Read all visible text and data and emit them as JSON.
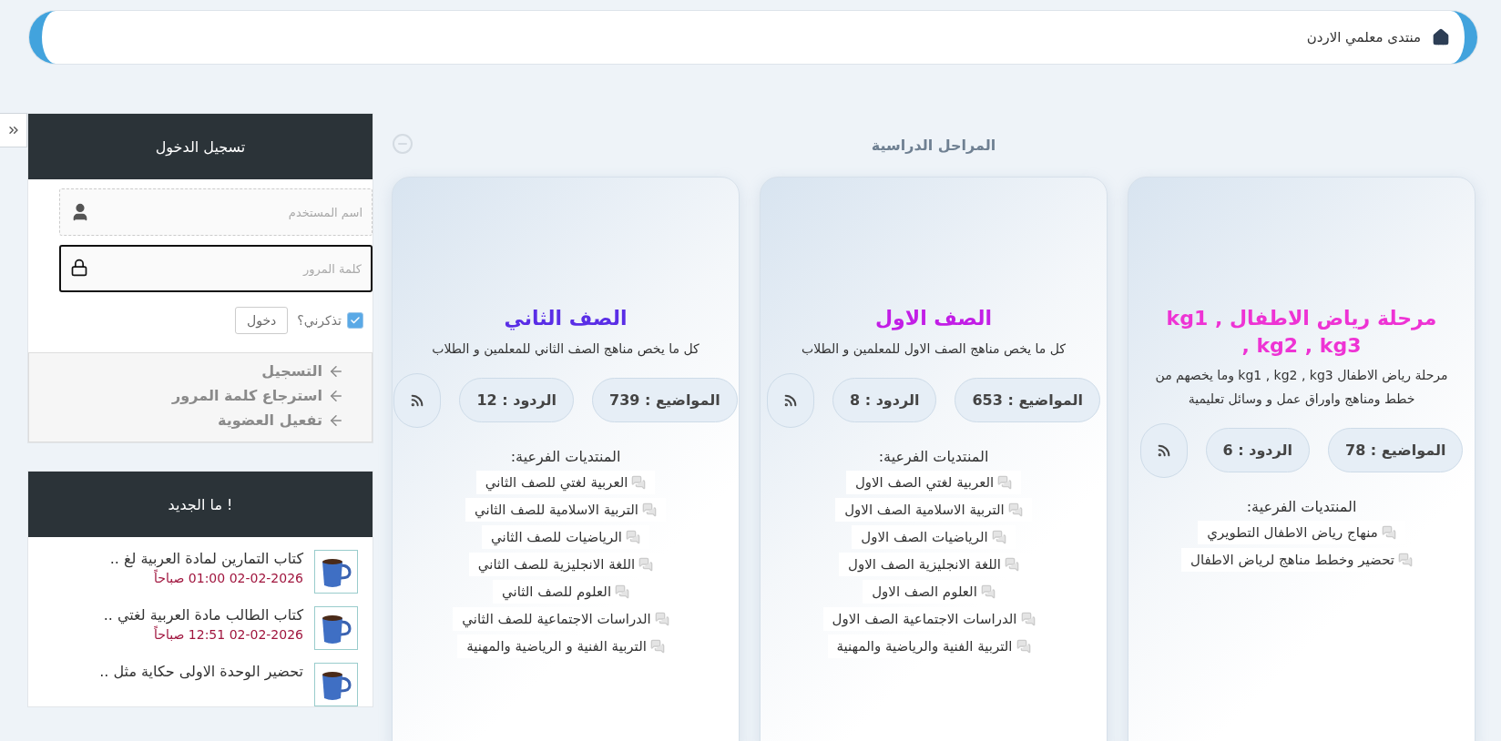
{
  "breadcrumb": {
    "title": "منتدى معلمي الاردن"
  },
  "login": {
    "title": "تسجيل الدخول",
    "username": {
      "placeholder": "اسم المستخدم"
    },
    "password": {
      "placeholder": "كلمة المرور"
    },
    "remember": {
      "label": "تذكرني؟",
      "checked": true
    },
    "submit": "دخول",
    "links": [
      "التسجيل",
      "استرجاع كلمة المرور",
      "تفعيل العضوية"
    ]
  },
  "whats_new": {
    "title": "ما الجديد !",
    "items": [
      {
        "title": "كتاب التمارين لمادة العربية لغ ..",
        "time": "02-02-2026 01:00 صباحاً"
      },
      {
        "title": "كتاب الطالب مادة العربية لغتي ..",
        "time": "02-02-2026 12:51 صباحاً"
      },
      {
        "title": "تحضير الوحدة الاولى حكاية مثل .."
      }
    ]
  },
  "section": {
    "title": "المراحل الدراسية",
    "expanded": true
  },
  "categories": [
    {
      "title": "مرحلة رياض الاطفال kg1 , kg2 , kg3 ,",
      "color": "#ee33d4",
      "description": "مرحلة رياض الاطفال kg1 , kg2 , kg3 وما يخصهم من خطط ومناهج واوراق عمل و وسائل تعليمية",
      "topics": "المواضيع : 78",
      "replies": "الردود : 6",
      "subforums_label": "المنتديات الفرعية:",
      "subforums": [
        "منهاج رياض الاطفال التطويري",
        "تحضير وخطط مناهج لرياض الاطفال"
      ]
    },
    {
      "title": "الصف الاول",
      "color": "#c21ee6",
      "description": "كل ما يخص مناهج الصف الاول للمعلمين و الطلاب",
      "topics": "المواضيع : 653",
      "replies": "الردود : 8",
      "subforums_label": "المنتديات الفرعية:",
      "subforums": [
        "العربية لغتي الصف الاول",
        "التربية الاسلامية الصف الاول",
        "الرياضيات الصف الاول",
        "اللغة الانجليزية الصف الاول",
        "العلوم الصف الاول",
        "الدراسات الاجتماعية الصف الاول",
        "التربية الفنية والرياضية والمهنية"
      ]
    },
    {
      "title": "الصف الثاني",
      "color": "#5a2ee6",
      "description": "كل ما يخص مناهج الصف الثاني للمعلمين و الطلاب",
      "topics": "المواضيع : 739",
      "replies": "الردود : 12",
      "subforums_label": "المنتديات الفرعية:",
      "subforums": [
        "العربية لغتي للصف الثاني",
        "التربية الاسلامية للصف الثاني",
        "الرياضيات للصف الثاني",
        "اللغة الانجليزية للصف الثاني",
        "العلوم للصف الثاني",
        "الدراسات الاجتماعية للصف الثاني",
        "التربية الفنية و الرياضية والمهنية"
      ]
    }
  ]
}
